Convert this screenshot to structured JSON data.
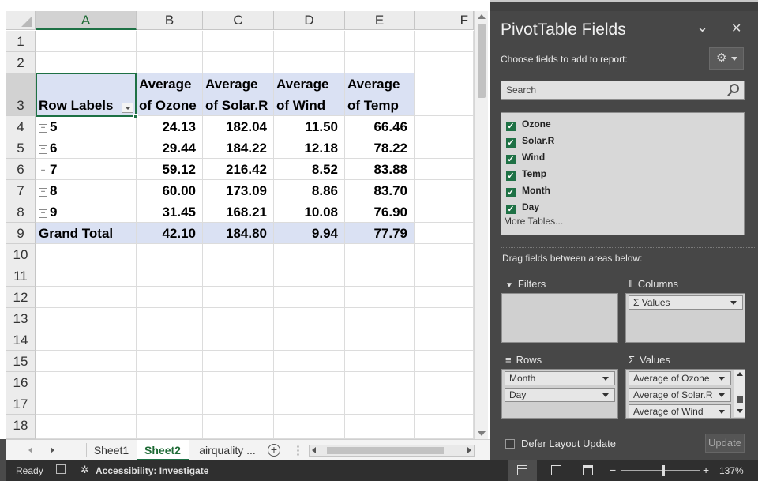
{
  "grid": {
    "columns": [
      "A",
      "B",
      "C",
      "D",
      "E",
      "F"
    ],
    "rows": [
      "1",
      "2",
      "3",
      "4",
      "5",
      "6",
      "7",
      "8",
      "9",
      "10",
      "11",
      "12",
      "13",
      "14",
      "15",
      "16",
      "17",
      "18"
    ],
    "pivot": {
      "row_labels_header": "Row Labels",
      "value_headers": [
        {
          "line1": "Average",
          "line2": "of Ozone"
        },
        {
          "line1": "Average",
          "line2": "of Solar.R"
        },
        {
          "line1": "Average",
          "line2": "of Wind"
        },
        {
          "line1": "Average",
          "line2": "of Temp"
        }
      ],
      "expand_glyph": "⊞",
      "rows": [
        {
          "label": "5",
          "values": [
            "24.13",
            "182.04",
            "11.50",
            "66.46"
          ]
        },
        {
          "label": "6",
          "values": [
            "29.44",
            "184.22",
            "12.18",
            "78.22"
          ]
        },
        {
          "label": "7",
          "values": [
            "59.12",
            "216.42",
            "8.52",
            "83.88"
          ]
        },
        {
          "label": "8",
          "values": [
            "60.00",
            "173.09",
            "8.86",
            "83.70"
          ]
        },
        {
          "label": "9",
          "values": [
            "31.45",
            "168.21",
            "10.08",
            "76.90"
          ]
        }
      ],
      "grand_total": {
        "label": "Grand Total",
        "values": [
          "42.10",
          "184.80",
          "9.94",
          "77.79"
        ]
      }
    }
  },
  "tabs": {
    "sheets": [
      "Sheet1",
      "Sheet2",
      "airquality ..."
    ],
    "active": "Sheet2",
    "add_glyph": "+",
    "more_glyph": "⋮"
  },
  "status": {
    "ready": "Ready",
    "accessibility": "Accessibility: Investigate",
    "zoom": "137%",
    "zoom_minus": "−",
    "zoom_plus": "+"
  },
  "pane": {
    "title": "PivotTable Fields",
    "choose_text": "Choose fields to add to report:",
    "search_placeholder": "Search",
    "fields": [
      "Ozone",
      "Solar.R",
      "Wind",
      "Temp",
      "Month",
      "Day"
    ],
    "more_tables": "More Tables...",
    "drag_text": "Drag fields between areas below:",
    "filters_label": "Filters",
    "columns_label": "Columns",
    "rows_label": "Rows",
    "values_label": "Values",
    "columns_items": [
      "Σ Values"
    ],
    "rows_items": [
      "Month",
      "Day"
    ],
    "values_items": [
      "Average of Ozone",
      "Average of Solar.R",
      "Average of Wind"
    ],
    "defer_label": "Defer Layout Update",
    "update_label": "Update",
    "icons": {
      "collapse": "chevron-down-icon",
      "close": "close-icon",
      "gear": "gear-icon"
    },
    "glyphs": {
      "chevron": "⌄",
      "close": "✕",
      "gear": "⚙",
      "filter": "▼",
      "columns": "⦀",
      "rows": "≡",
      "sigma": "Σ",
      "check": "✓"
    }
  },
  "colors": {
    "accent": "#1e7145",
    "pivot_header": "#dae1f3",
    "pane_bg": "#474747"
  }
}
